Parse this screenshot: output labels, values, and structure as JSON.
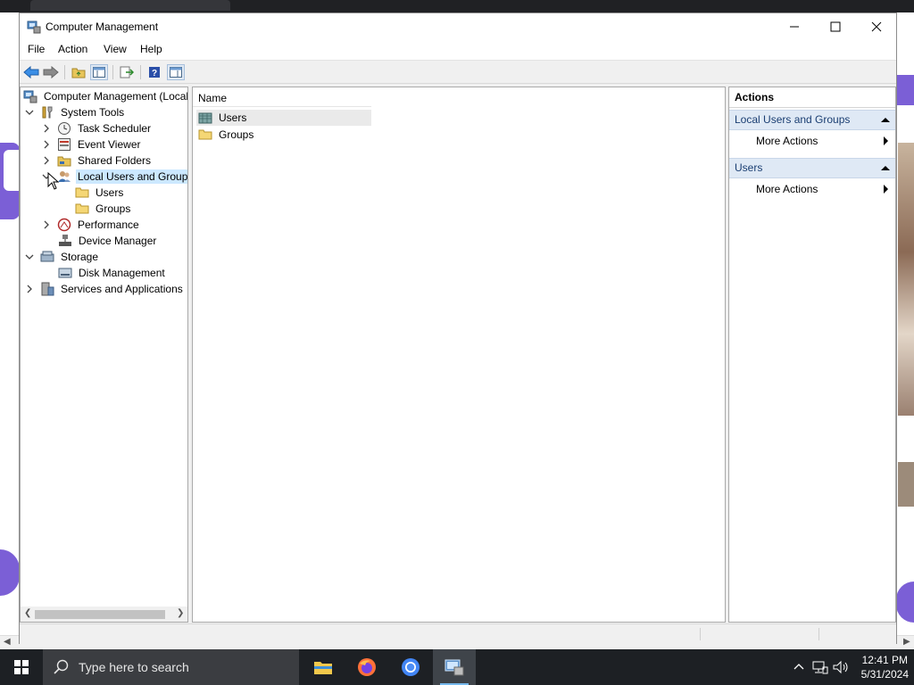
{
  "window": {
    "title": "Computer Management",
    "controls": {
      "minimize": "minimize-icon",
      "maximize": "maximize-icon",
      "close": "close-icon"
    }
  },
  "menu": [
    "File",
    "Action",
    "View",
    "Help"
  ],
  "toolbar": {
    "buttons": [
      "back-arrow-icon",
      "forward-arrow-icon",
      "up-folder-icon",
      "show-hide-tree-icon",
      "export-list-icon",
      "help-icon",
      "show-hide-action-pane-icon"
    ]
  },
  "tree": {
    "items": [
      {
        "label": "Computer Management (Local",
        "icon": "computer-management-icon",
        "expander": ""
      },
      {
        "label": "System Tools",
        "icon": "tools-icon",
        "expander": "expanded"
      },
      {
        "label": "Task Scheduler",
        "icon": "clock-icon",
        "expander": "collapsed"
      },
      {
        "label": "Event Viewer",
        "icon": "event-viewer-icon",
        "expander": "collapsed"
      },
      {
        "label": "Shared Folders",
        "icon": "shared-folders-icon",
        "expander": "collapsed"
      },
      {
        "label": "Local Users and Groups",
        "icon": "users-groups-icon",
        "expander": "expanded"
      },
      {
        "label": "Users",
        "icon": "folder-icon",
        "expander": ""
      },
      {
        "label": "Groups",
        "icon": "folder-icon",
        "expander": ""
      },
      {
        "label": "Performance",
        "icon": "performance-icon",
        "expander": "collapsed"
      },
      {
        "label": "Device Manager",
        "icon": "device-manager-icon",
        "expander": ""
      },
      {
        "label": "Storage",
        "icon": "storage-icon",
        "expander": "expanded"
      },
      {
        "label": "Disk Management",
        "icon": "disk-management-icon",
        "expander": ""
      },
      {
        "label": "Services and Applications",
        "icon": "services-icon",
        "expander": "collapsed"
      }
    ]
  },
  "list": {
    "column_header": "Name",
    "rows": [
      {
        "label": "Users",
        "icon": "users-folder-icon"
      },
      {
        "label": "Groups",
        "icon": "folder-icon"
      }
    ]
  },
  "actions": {
    "header": "Actions",
    "group1": {
      "label": "Local Users and Groups",
      "item": "More Actions"
    },
    "group2": {
      "label": "Users",
      "item": "More Actions"
    }
  },
  "taskbar": {
    "search_placeholder": "Type here to search",
    "time": "12:41 PM",
    "date": "5/31/2024"
  }
}
